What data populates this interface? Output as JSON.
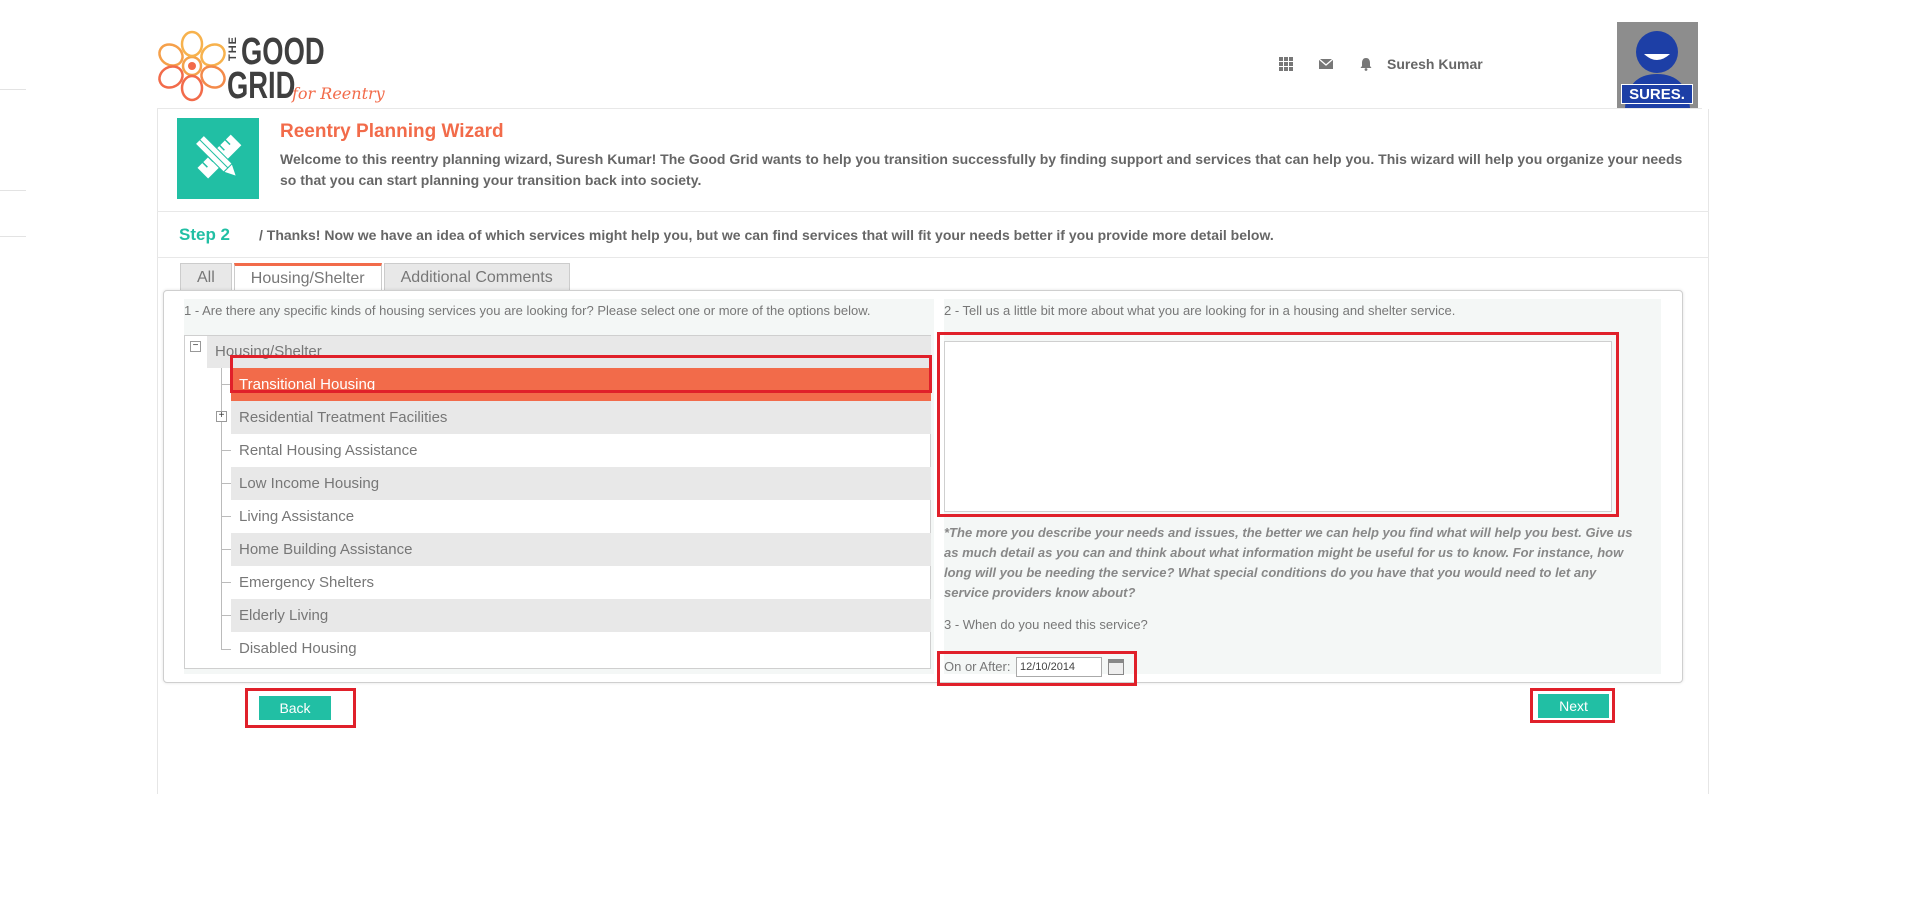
{
  "header": {
    "logo": {
      "the": "THE",
      "good": "GOOD",
      "grid": "GRID",
      "tagline": "for Reentry"
    },
    "icons": [
      "apps-grid-icon",
      "envelope-icon",
      "bell-icon"
    ],
    "user_name": "Suresh Kumar",
    "avatar_label": "SURES."
  },
  "wizard": {
    "title": "Reentry Planning Wizard",
    "intro": "Welcome to this reentry planning wizard, Suresh Kumar! The Good Grid wants to help you transition successfully by finding support and services that can help you. This wizard will help you organize your needs so that you can start planning your transition back into society.",
    "step_label": "Step 2",
    "step_text": "/ Thanks! Now we have an idea of which services might help you, but we can find services that will fit your needs better if you provide more detail below."
  },
  "tabs": [
    {
      "label": "All",
      "active": false
    },
    {
      "label": "Housing/Shelter",
      "active": true
    },
    {
      "label": "Additional Comments",
      "active": false
    }
  ],
  "question1": {
    "label": "1 - Are there any specific kinds of housing services you are looking for? Please select one or more of the options below.",
    "root": "Housing/Shelter",
    "items": [
      {
        "label": "Transitional Housing",
        "selected": true,
        "expandable": false
      },
      {
        "label": "Residential Treatment Facilities",
        "selected": false,
        "expandable": true
      },
      {
        "label": "Rental Housing Assistance",
        "selected": false,
        "expandable": false
      },
      {
        "label": "Low Income Housing",
        "selected": false,
        "expandable": false
      },
      {
        "label": "Living Assistance",
        "selected": false,
        "expandable": false
      },
      {
        "label": "Home Building Assistance",
        "selected": false,
        "expandable": false
      },
      {
        "label": "Emergency Shelters",
        "selected": false,
        "expandable": false
      },
      {
        "label": "Elderly Living",
        "selected": false,
        "expandable": false
      },
      {
        "label": "Disabled Housing",
        "selected": false,
        "expandable": false
      }
    ]
  },
  "question2": {
    "label": "2 - Tell us a little bit more about what you are looking for in a housing and shelter service.",
    "value": "",
    "note": "*The more you describe your needs and issues, the better we can help you find what will help you best. Give us as much detail as you can and think about what information might be useful for us to know. For instance, how long will you be needing the service? What special conditions do you have that you would need to let any service providers know about?"
  },
  "question3": {
    "label": "3 - When do you need this service?",
    "date_label": "On or After:",
    "date_value": "12/10/2014"
  },
  "buttons": {
    "back": "Back",
    "next": "Next"
  },
  "colors": {
    "accent_teal": "#21bfa4",
    "accent_orange": "#f26b4a",
    "highlight_red": "#e0202a"
  }
}
